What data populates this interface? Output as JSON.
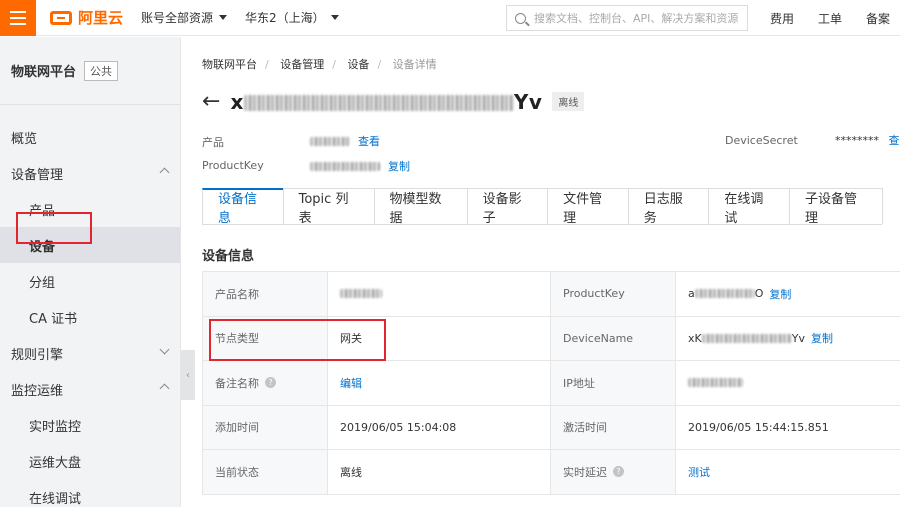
{
  "topbar": {
    "logo_text": "阿里云",
    "account": "账号全部资源",
    "region": "华东2（上海）",
    "search_placeholder": "搜索文档、控制台、API、解决方案和资源",
    "fee": "费用",
    "ticket": "工单",
    "record": "备案"
  },
  "sidebar": {
    "title": "物联网平台",
    "badge": "公共",
    "items": [
      {
        "label": "概览"
      },
      {
        "label": "设备管理"
      },
      {
        "label": "产品"
      },
      {
        "label": "设备"
      },
      {
        "label": "分组"
      },
      {
        "label": "CA 证书"
      },
      {
        "label": "规则引擎"
      },
      {
        "label": "监控运维"
      },
      {
        "label": "实时监控"
      },
      {
        "label": "运维大盘"
      },
      {
        "label": "在线调试"
      }
    ]
  },
  "breadcrumb": [
    "物联网平台",
    "设备管理",
    "设备",
    "设备详情"
  ],
  "device": {
    "title_prefix": "x",
    "title_suffix": "Yv",
    "status": "离线",
    "product_label": "产品",
    "view_link": "查看",
    "productkey_label": "ProductKey",
    "copy_link": "复制",
    "secret_label": "DeviceSecret",
    "secret_value": "********",
    "secret_view": "查看"
  },
  "tabs": [
    "设备信息",
    "Topic 列表",
    "物模型数据",
    "设备影子",
    "文件管理",
    "日志服务",
    "在线调试",
    "子设备管理"
  ],
  "section_title": "设备信息",
  "info": {
    "product_name_label": "产品名称",
    "productkey_label": "ProductKey",
    "productkey_prefix": "a",
    "productkey_suffix": "O",
    "copy1": "复制",
    "node_type_label": "节点类型",
    "node_type_value": "网关",
    "devicename_label": "DeviceName",
    "devicename_prefix": "xK",
    "devicename_suffix": "Yv",
    "copy2": "复制",
    "remark_label": "备注名称",
    "edit_link": "编辑",
    "ip_label": "IP地址",
    "added_label": "添加时间",
    "added_value": "2019/06/05 15:04:08",
    "activated_label": "激活时间",
    "activated_value": "2019/06/05 15:44:15.851",
    "state_label": "当前状态",
    "state_value": "离线",
    "latency_label": "实时延迟",
    "test_link": "测试"
  },
  "colors": {
    "brand": "#ff6a00",
    "link": "#0070cc",
    "highlight": "#e0262e"
  }
}
